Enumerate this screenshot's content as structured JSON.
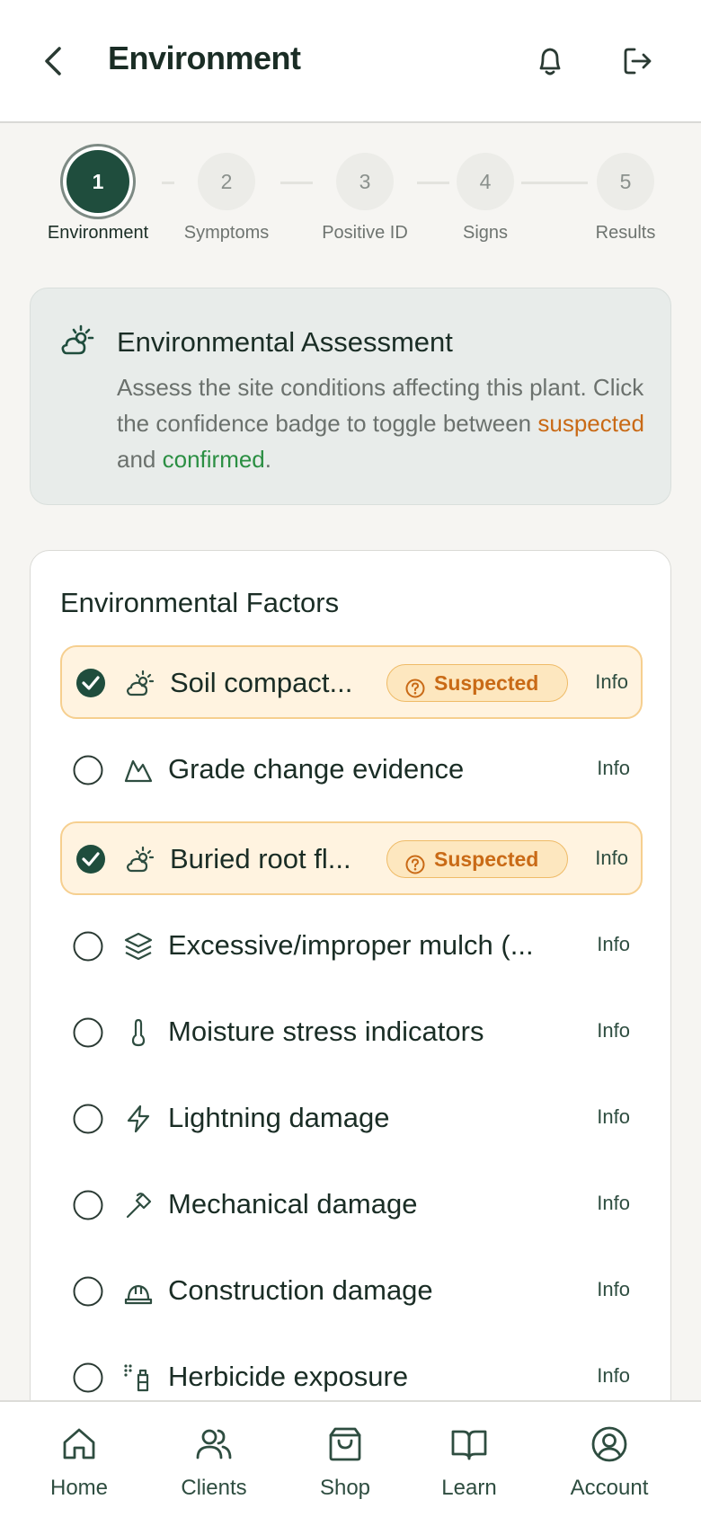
{
  "header": {
    "title": "Environment"
  },
  "stepper": {
    "steps": [
      {
        "number": "1",
        "label": "Environment"
      },
      {
        "number": "2",
        "label": "Symptoms"
      },
      {
        "number": "3",
        "label": "Positive ID"
      },
      {
        "number": "4",
        "label": "Signs"
      },
      {
        "number": "5",
        "label": "Results"
      }
    ]
  },
  "assessment": {
    "title": "Environmental Assessment",
    "text_before": "Assess the site conditions affecting this plant. Click the confidence badge to toggle between ",
    "suspected": "suspected",
    "and": " and ",
    "confirmed": "confirmed",
    "period": "."
  },
  "factors": {
    "title": "Environmental Factors",
    "info_label": "Info",
    "items": [
      {
        "label": "Soil compact...",
        "icon": "weather-icon",
        "checked": true,
        "badge": "Suspected"
      },
      {
        "label": "Grade change evidence",
        "icon": "mountain-icon",
        "checked": false
      },
      {
        "label": "Buried root fl...",
        "icon": "weather-icon",
        "checked": true,
        "badge": "Suspected"
      },
      {
        "label": "Excessive/improper mulch (...",
        "icon": "layers-icon",
        "checked": false
      },
      {
        "label": "Moisture stress indicators",
        "icon": "thermometer-icon",
        "checked": false
      },
      {
        "label": "Lightning damage",
        "icon": "lightning-icon",
        "checked": false
      },
      {
        "label": "Mechanical damage",
        "icon": "hammer-icon",
        "checked": false
      },
      {
        "label": "Construction damage",
        "icon": "hardhat-icon",
        "checked": false
      },
      {
        "label": "Herbicide exposure",
        "icon": "spray-icon",
        "checked": false
      }
    ]
  },
  "nav": {
    "items": [
      {
        "label": "Home",
        "icon": "home-icon"
      },
      {
        "label": "Clients",
        "icon": "users-icon"
      },
      {
        "label": "Shop",
        "icon": "shopping-bag-icon"
      },
      {
        "label": "Learn",
        "icon": "book-icon"
      },
      {
        "label": "Account",
        "icon": "account-icon"
      }
    ]
  },
  "colors": {
    "primary": "#1f4d3d",
    "suspected": "#c96a16",
    "confirmed": "#2b8f43",
    "selected_bg": "#fff3e0"
  }
}
